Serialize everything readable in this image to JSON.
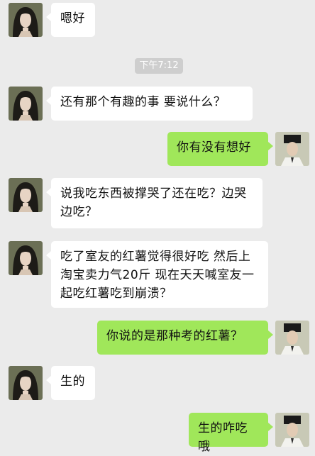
{
  "timestamp": "下午7:12",
  "messages": [
    {
      "side": "left",
      "text": "嗯好"
    },
    {
      "side": "left",
      "text": "还有那个有趣的事 要说什么？"
    },
    {
      "side": "right",
      "text": "你有没有想好"
    },
    {
      "side": "left",
      "text": "说我吃东西被撑哭了还在吃？边哭边吃？"
    },
    {
      "side": "left",
      "text": "吃了室友的红薯觉得很好吃 然后上淘宝卖力气20斤 现在天天喊室友一起吃红薯吃到崩溃？"
    },
    {
      "side": "right",
      "text": "你说的是那种考的红薯？"
    },
    {
      "side": "left",
      "text": "生的"
    },
    {
      "side": "right",
      "text": "生的咋吃哦"
    }
  ],
  "colors": {
    "background": "#ebebeb",
    "bubble_self": "#a0e75a",
    "bubble_other": "#ffffff"
  },
  "avatars": {
    "left": "long-hair-woman-avatar",
    "right": "period-costume-man-avatar"
  }
}
